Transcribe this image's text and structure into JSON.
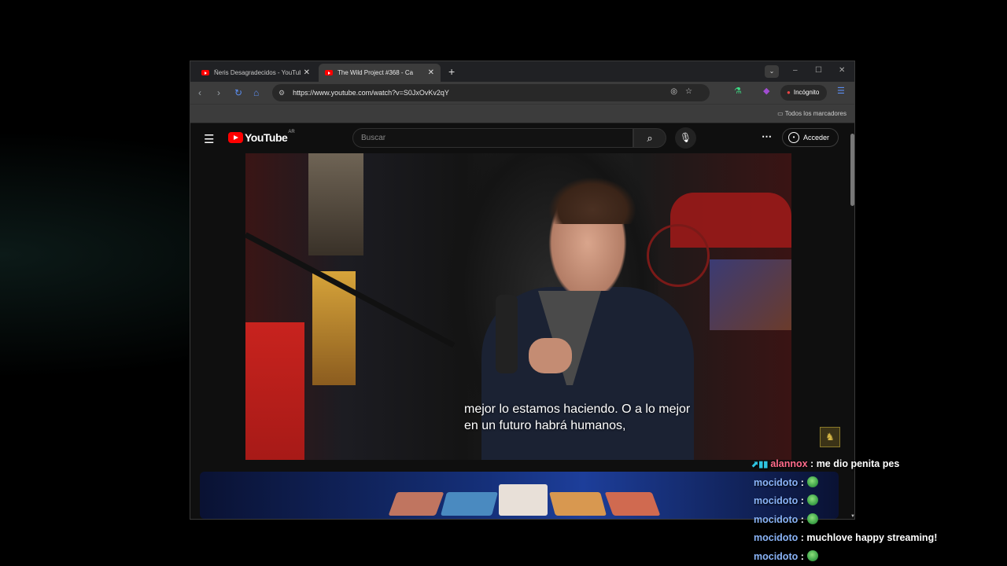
{
  "browser": {
    "tabs": [
      {
        "title": "Ñeris Desagradecidos - YouTube",
        "active": false
      },
      {
        "title": "The Wild Project #368 - Ca",
        "active": true
      }
    ],
    "url": "https://www.youtube.com/watch?v=S0JxOvKv2qY",
    "incognito_label": "Incógnito",
    "bookmarks_label": "Todos los marcadores"
  },
  "youtube": {
    "logo_text": "YouTube",
    "country_code": "AR",
    "search_placeholder": "Buscar",
    "signin_label": "Acceder"
  },
  "video": {
    "subtitle_lines": [
      "mejor lo estamos haciendo. O a lo mejor",
      "en un futuro habrá humanos,"
    ]
  },
  "chat": {
    "messages": [
      {
        "user": "alannox",
        "message": "me dio penita pes",
        "user_color": "#ff6b8b",
        "has_badges": true
      },
      {
        "user": "mocidoto",
        "message": "",
        "emote": "green-emote"
      },
      {
        "user": "mocidoto",
        "message": "",
        "emote": "green-emote"
      },
      {
        "user": "mocidoto",
        "message": "",
        "emote": "green-emote"
      },
      {
        "user": "mocidoto",
        "message": "muchlove happy streaming!"
      },
      {
        "user": "mocidoto",
        "message": "",
        "emote": "green-emote"
      }
    ]
  },
  "colors": {
    "accent_red": "#ff0000",
    "chat_user": "#8ab4f8",
    "chat_user_highlight": "#ff6b8b"
  }
}
